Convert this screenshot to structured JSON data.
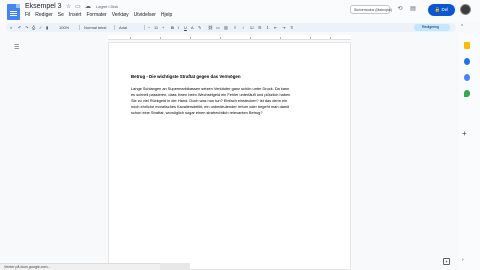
{
  "header": {
    "title": "Eksempel 3",
    "save_status": "Lagret i Disk",
    "menu": [
      "Fil",
      "Rediger",
      "Se",
      "Insert",
      "Formater",
      "Verktøy",
      "Utvidelser",
      "Hjelp"
    ],
    "mode_label": "Skrivemodus (Makropai)",
    "share_label": "Del",
    "brand_color": "#0b57d0"
  },
  "toolbar": {
    "zoom": "100%",
    "style": "Normal tekst",
    "font": "Arial",
    "font_size": "11",
    "edit_mode": "Redigering"
  },
  "document": {
    "heading": "Betrug - Die wichtigste Straftat gegen das Vermögen",
    "paragraph_lines": [
      "Lange Schlangen an Supermarktkassen setzen Verkäufer ganz schön unter Druck. Da kann",
      "es schnell passieren, dass ihnen beim Wechselgeld ein Fehler unterläuft und plötzlich haben",
      "Sie zu viel Rückgeld in der Hand. Doch was nun tun? Einfach einstecken? Ist das denn ein",
      "noch ehrliche moralisches Kavaliersdelikt, ein unbedeutender Irrtum oder begeht man damit",
      "schon eine Straftat, womöglich sogar einen strafrechtlich relevanten Betrug?"
    ]
  },
  "status": {
    "text": "Venter på docs.google.com..."
  },
  "icons": {
    "docs_logo": "docs-logo-icon",
    "sidepanel": [
      "keep-icon",
      "tasks-icon",
      "contacts-icon",
      "maps-icon"
    ]
  }
}
